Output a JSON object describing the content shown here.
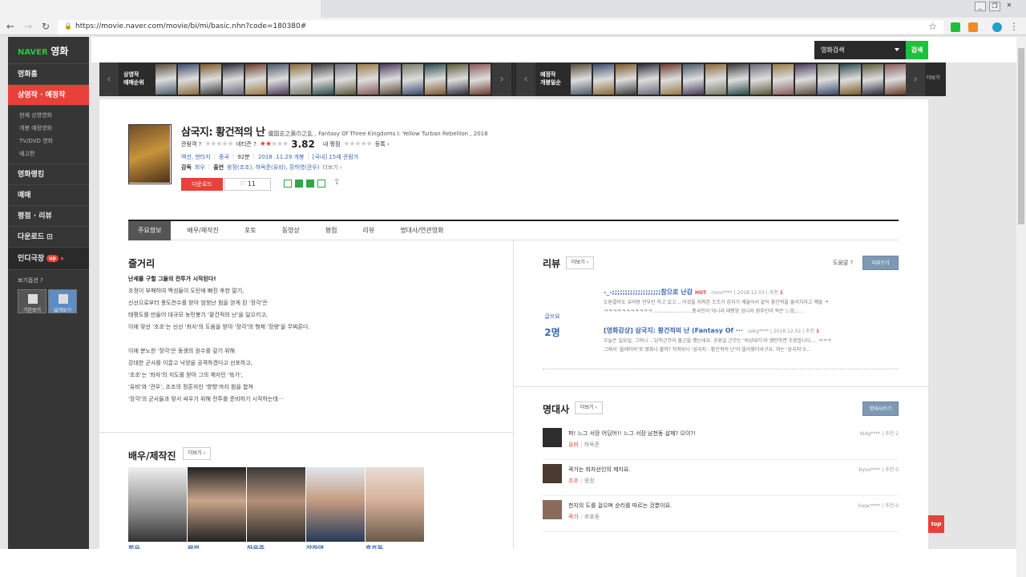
{
  "browser": {
    "url": "https://movie.naver.com/movie/bi/mi/basic.nhn?code=180380#"
  },
  "sidebar": {
    "logo_naver": "NAVER",
    "logo_movie": "영화",
    "items": [
      {
        "label": "영화홈"
      },
      {
        "label": "상영작 · 예정작"
      }
    ],
    "subitems": [
      "현재 상영영화",
      "개봉 예정영화",
      "TV/DVD 영화",
      "예고편"
    ],
    "items2": [
      {
        "label": "영화랭킹"
      },
      {
        "label": "예매"
      },
      {
        "label": "평점 · 리뷰"
      },
      {
        "label": "다운로드 ⊡"
      }
    ],
    "indie": "인디극장",
    "indie_badge": "up",
    "view_options": "보기옵션 ?",
    "view_basic": "기본보기",
    "view_wide": "넓게보기"
  },
  "search": {
    "select": "영화검색",
    "button": "검색"
  },
  "strip": {
    "left_label": "상영작\n예매순위",
    "right_label": "예정작\n개봉일순",
    "more": "더보기"
  },
  "movie": {
    "title": "삼국지: 황건적의 난",
    "subtitle": "魔国志之黄巾之乱 , Fantasy Of Three Kingdoms I: Yellow Turban Rebellion , 2018",
    "audience_label": "관람객 ?",
    "audience_stars": "★★★★★",
    "netizen_label": "네티즌 ?",
    "netizen_score": "3.82",
    "my_label": "내 평점",
    "my_stars": "★★★★★",
    "register": "등록 ›",
    "genre": "액션, 판타지",
    "country": "중국",
    "runtime": "92분",
    "release": "2018 .11.29 개봉",
    "rating": "[국내] 15세 관람가",
    "director_label": "감독",
    "director": "회우",
    "cast_label": "출연",
    "cast": "왕정(조조), 하옥준(유비), 장하영(관우)",
    "cast_more": "더보기 ›",
    "download": "다운로드",
    "likes": "11"
  },
  "tabs": [
    "주요정보",
    "배우/제작진",
    "포토",
    "동영상",
    "평점",
    "리뷰",
    "명대사/연관영화"
  ],
  "synopsis": {
    "heading": "줄거리",
    "lead": "난세를 구할 그들의 전투가 시작된다!",
    "lines": [
      "조정이 부패하여 백성들이 도탄에 빠진 후한 말기,",
      "신선으로부터 풍도천수를 받아 엄청난 힘을 얻게 된 '장각'은",
      "태평도를 만들어 대규모 농민봉기 '황건적의 난'을 일으키고,",
      "이에 맞선 '조조'는 신선 '좌자'의 도움을 받아 '장각'의 형제 '장량'을 무찌른다.",
      "",
      "이에 분노한 '장각'은 동생의 원수를 갚기 위해",
      "강대한 군사를 이끌고 낙양을 공격하겠다고 선포하고,",
      "'조조'는 '좌자'의 지도를 받아 그의 제자인 '육가',",
      "'유비'와 '관우', 조조의 정혼자인 '향향'까지 힘을 합쳐",
      "'장각'의 군사들과 맞서 싸우기 위해 전투를 준비하기 시작하는데···"
    ]
  },
  "cast_section": {
    "heading": "배우/제작진",
    "more": "더보기 ›",
    "names": [
      "회우",
      "왕정",
      "하옥준",
      "장하영",
      "후효동"
    ]
  },
  "review": {
    "heading": "리뷰",
    "more": "더보기 ›",
    "help": "도움말 ?",
    "write": "리뷰쓰기",
    "count_label": "글쓰요",
    "count": "2명",
    "items": [
      {
        "title": "-_-;;;;;;;;;;;;;;;;;;;참으로 난감",
        "hot": "HOT",
        "user": "mins****",
        "date": "2018.12.03",
        "rec_label": "추천",
        "rec": "1",
        "desc": "도원결의도 유비랑 관우만 하고 있고... 이것을 지켜본 조조가 갑자기 깨들어서 같이 황건적을 물리치자고 꼐들 ㅋ",
        "desc2": "ㅋㅋㅋㅋㅋㅋㅋㅋㅋㅋㅋ..........................중국인이 아니라 태평양 섬나라 원주민이 찍은 느낌;; ..."
      },
      {
        "title": "[영화감상] 삼국지: 황건적의 난 (Fantasy Of ···",
        "hot": "",
        "user": "sakg****",
        "date": "2018.12.02",
        "rec_label": "추천",
        "rec": "1",
        "desc": "오늘은 일요일, 그러나 ...당직근무라 출근을 했는데요. 공휴일 근무는 '비상대기'라 웬만하면 조용합니다.... ㅋㅋㅋ",
        "desc2": "그래서 '올레티비'로 영화나 볼까? 뒤져보니 '삼국지 : 황건적의 난'이 올라왔더라구요. 저는 '삼국지'소..."
      }
    ]
  },
  "lines_section": {
    "heading": "명대사",
    "more": "더보기 ›",
    "write": "명대사쓰기",
    "items": [
      {
        "quote": "퍼! 느그 서장 어딨어!! 느그 서장 남천동 살제? 으이?!",
        "role": "유비",
        "actor": "하옥준",
        "user": "tkdg****",
        "rec_label": "추천",
        "rec": "2"
      },
      {
        "quote": "곽가는 좌자선인의 제자요.",
        "role": "조조",
        "actor": "왕정",
        "user": "byou****",
        "rec_label": "추천",
        "rec": "0"
      },
      {
        "quote": "천지의 도를 걸으며 순리를 따르는 것뿐이요.",
        "role": "곽가",
        "actor": "후효동",
        "user": "kwac****",
        "rec_label": "추천",
        "rec": "0"
      }
    ]
  },
  "top_button": "top",
  "colors": {
    "accent": "#e8413a",
    "green": "#1fc13b",
    "link": "#3a66b0",
    "sidebar": "#363636"
  }
}
